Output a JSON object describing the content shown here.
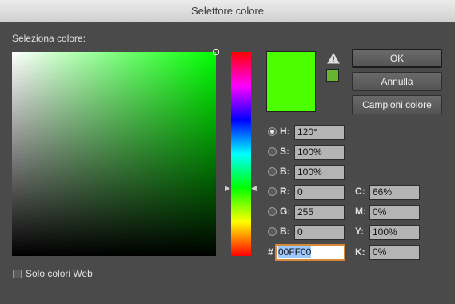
{
  "window": {
    "title": "Selettore colore"
  },
  "picker": {
    "label": "Seleziona colore:"
  },
  "warning": {
    "icon": "warning-triangle-icon"
  },
  "colors": {
    "current": "#4cff00",
    "websafe": "#66b530"
  },
  "buttons": {
    "ok": "OK",
    "cancel": "Annulla",
    "swatches": "Campioni colore"
  },
  "hsb": {
    "h": {
      "label": "H:",
      "value": "120°"
    },
    "s": {
      "label": "S:",
      "value": "100%"
    },
    "b": {
      "label": "B:",
      "value": "100%"
    }
  },
  "rgb": {
    "r": {
      "label": "R:",
      "value": "0"
    },
    "g": {
      "label": "G:",
      "value": "255"
    },
    "b": {
      "label": "B:",
      "value": "0"
    }
  },
  "cmyk": {
    "c": {
      "label": "C:",
      "value": "66%"
    },
    "m": {
      "label": "M:",
      "value": "0%"
    },
    "y": {
      "label": "Y:",
      "value": "100%"
    },
    "k": {
      "label": "K:",
      "value": "0%"
    }
  },
  "hex": {
    "symbol": "#",
    "value": "00FF00"
  },
  "web_only": {
    "label": "Solo colori Web",
    "checked": false
  }
}
